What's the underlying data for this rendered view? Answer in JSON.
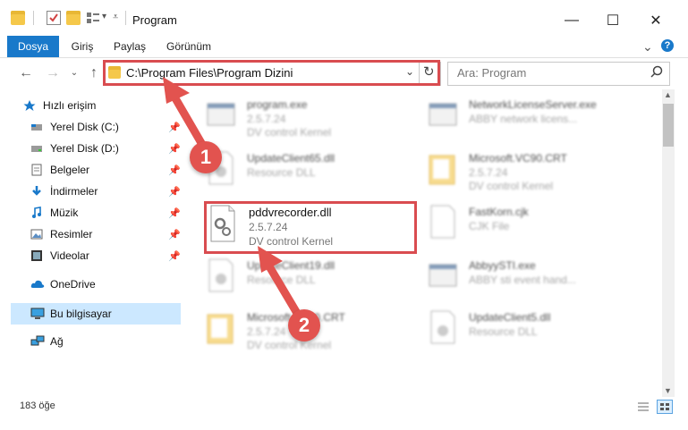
{
  "window": {
    "title": "Program",
    "minimize": "—",
    "maximize": "☐",
    "close": "✕"
  },
  "ribbon": {
    "tabs": [
      "Dosya",
      "Giriş",
      "Paylaş",
      "Görünüm"
    ],
    "expand": "⌄",
    "help": "?"
  },
  "address": {
    "path": "C:\\Program Files\\Program Dizini",
    "search_placeholder": "Ara: Program"
  },
  "sidebar": {
    "items": [
      {
        "label": "Hızlı erişim"
      },
      {
        "label": "Yerel Disk (C:)"
      },
      {
        "label": "Yerel Disk (D:)"
      },
      {
        "label": "Belgeler"
      },
      {
        "label": "İndirmeler"
      },
      {
        "label": "Müzik"
      },
      {
        "label": "Resimler"
      },
      {
        "label": "Videolar"
      },
      {
        "label": "OneDrive"
      },
      {
        "label": "Bu bilgisayar"
      },
      {
        "label": "Ağ"
      }
    ]
  },
  "files": [
    {
      "name": "program.exe",
      "line2": "2.5.7.24",
      "line3": "DV control Kernel"
    },
    {
      "name": "NetworkLicenseServer.exe",
      "line2": "ABBY network licens...",
      "line3": ""
    },
    {
      "name": "UpdateClient65.dll",
      "line2": "Resource DLL",
      "line3": ""
    },
    {
      "name": "Microsoft.VC90.CRT",
      "line2": "2.5.7.24",
      "line3": "DV control Kernel"
    },
    {
      "name": "pddvrecorder.dll",
      "line2": "2.5.7.24",
      "line3": "DV control Kernel"
    },
    {
      "name": "FastKorn.cjk",
      "line2": "CJK File",
      "line3": ""
    },
    {
      "name": "UpdateClient19.dll",
      "line2": "Resource DLL",
      "line3": ""
    },
    {
      "name": "AbbyySTI.exe",
      "line2": "ABBY sti event hand...",
      "line3": ""
    },
    {
      "name": "Microsoft.VC80.CRT",
      "line2": "2.5.7.24",
      "line3": "DV control Kernel"
    },
    {
      "name": "UpdateClient5.dll",
      "line2": "Resource DLL",
      "line3": ""
    }
  ],
  "annotations": {
    "badge1": "1",
    "badge2": "2"
  },
  "status": {
    "count": "183 öğe"
  },
  "colors": {
    "accent": "#1979ca",
    "highlight": "#d94c50",
    "selected": "#cce8ff"
  }
}
